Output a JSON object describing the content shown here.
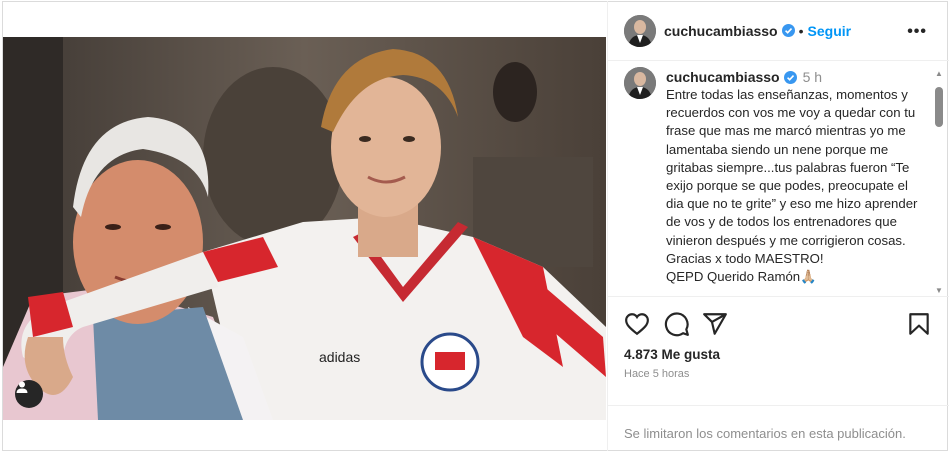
{
  "post": {
    "author": {
      "username": "cuchucambiasso",
      "verified": true,
      "avatar_icon": "profile-photo"
    },
    "follow_label": "Seguir",
    "header_dot": "•",
    "more_label": "•••",
    "caption": {
      "time_ago": "5 h",
      "text": "Entre todas las enseñanzas, momentos y recuerdos con vos me voy a quedar con tu frase que mas me marcó mientras yo me lamentaba siendo un nene porque me gritabas siempre...tus palabras fueron “Te exijo porque se que podes, preocupate el dia que no te grite” y eso me hizo aprender de vos y de todos los entrenadores que vinieron después y me corrigieron cosas. Gracias x todo MAESTRO!\nQEPD Querido Ramón🙏🏼"
    },
    "likes_label": "4.873 Me gusta",
    "posted_ago": "Hace 5 horas",
    "comments_disabled_notice": "Se limitaron los comentarios en esta publicación.",
    "photo": {
      "description_icon": "photo-two-men",
      "jersey_brand": "adidas"
    },
    "icons": {
      "like": "heart-icon",
      "comment": "comment-icon",
      "share": "share-icon",
      "save": "bookmark-icon",
      "tagged_users": "user-tag-icon",
      "verified": "verified-badge-icon"
    },
    "colors": {
      "accent": "#0095f6",
      "text": "#262626",
      "muted": "#8e8e8e",
      "border": "#efefef"
    }
  }
}
